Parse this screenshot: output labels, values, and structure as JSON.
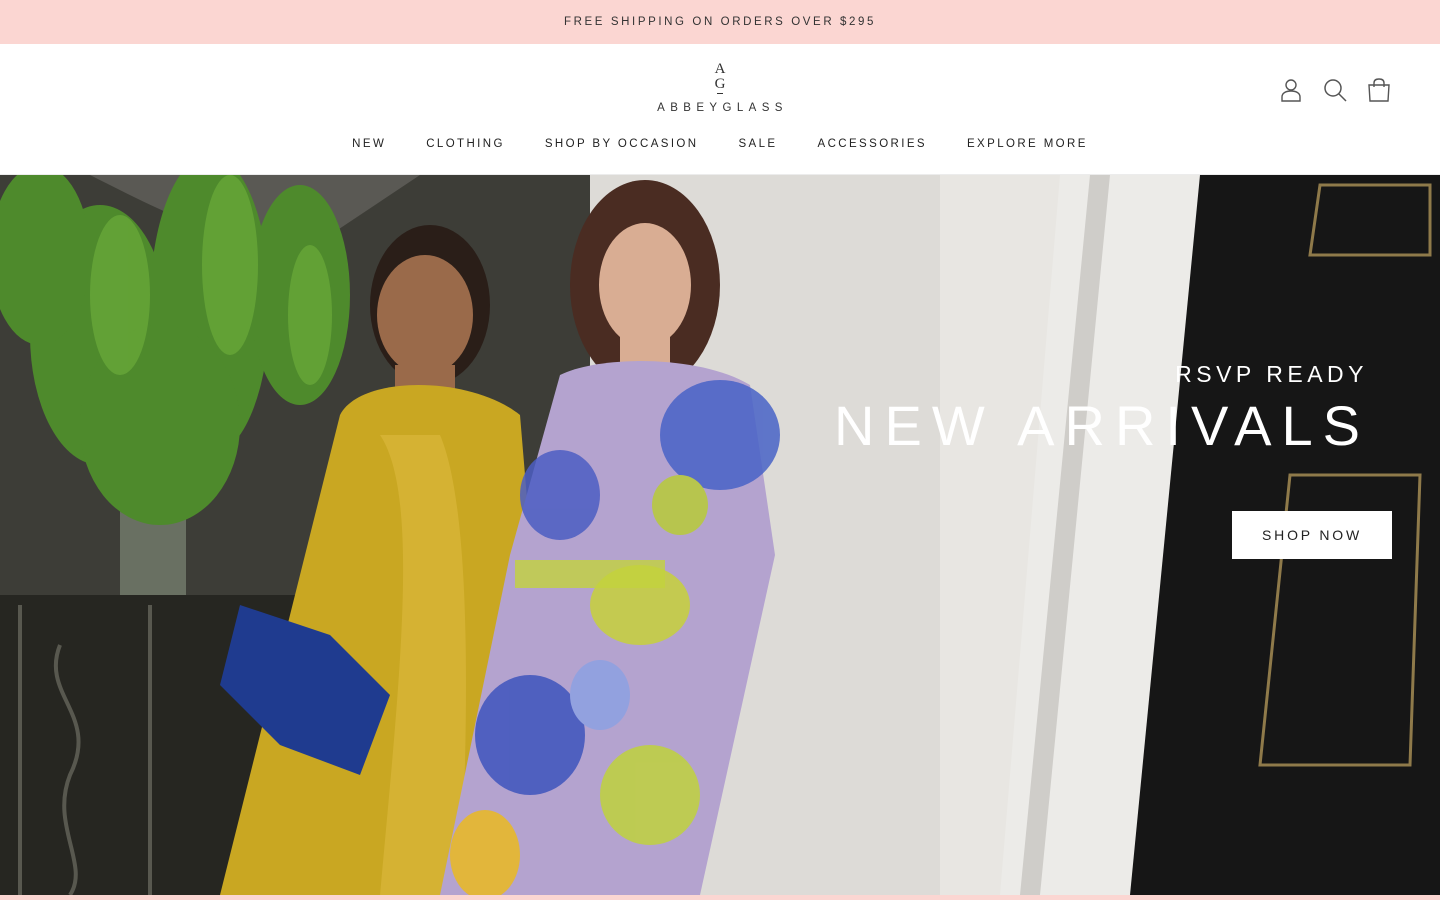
{
  "announcement": {
    "text": "FREE SHIPPING ON ORDERS OVER $295"
  },
  "brand": {
    "monogram_top": "A",
    "monogram_bottom": "G",
    "wordmark": "ABBEYGLASS"
  },
  "header_icons": [
    {
      "name": "account",
      "icon": "user-icon"
    },
    {
      "name": "search",
      "icon": "search-icon"
    },
    {
      "name": "cart",
      "icon": "shopping-bag-icon"
    }
  ],
  "nav": {
    "items": [
      {
        "label": "NEW"
      },
      {
        "label": "CLOTHING"
      },
      {
        "label": "SHOP BY OCCASION"
      },
      {
        "label": "SALE"
      },
      {
        "label": "ACCESSORIES"
      },
      {
        "label": "EXPLORE MORE"
      }
    ]
  },
  "hero": {
    "kicker": "RSVP READY",
    "title": "NEW ARRIVALS",
    "cta_label": "SHOP NOW",
    "image_description_icon": "hero-photo"
  },
  "colors": {
    "announcement_bg": "#fbd6d2",
    "text": "#222222",
    "hero_text": "#ffffff"
  }
}
